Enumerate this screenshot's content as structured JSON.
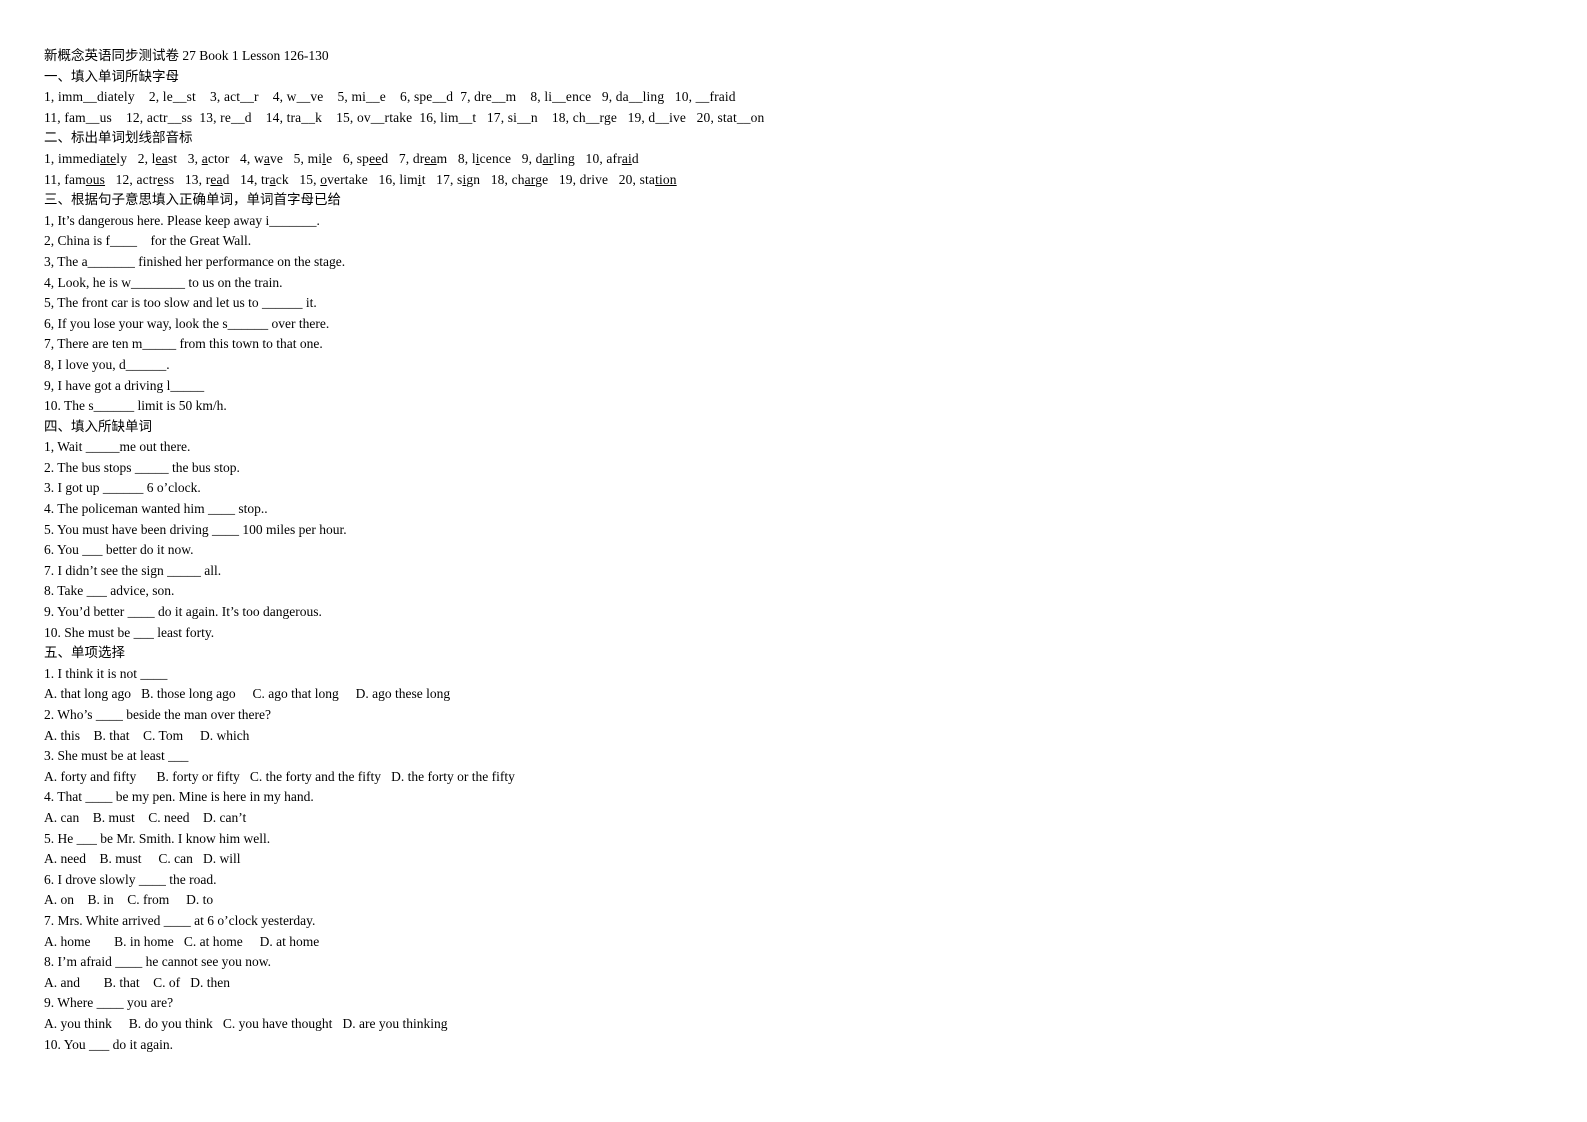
{
  "document": {
    "title": "新概念英语同步测试卷 27 Book 1 Lesson 126-130",
    "sections": [
      {
        "id": "section-1",
        "heading": "一、填入单词所缺字母",
        "lines": [
          "1, imm__diately    2, le__st    3, act__r    4, w__ve    5, mi__e    6, spe__d  7, dre__m    8, li__ence   9, da__ling   10, __fraid",
          "11, fam__us    12, actr__ss  13, re__d    14, tra__k    15, ov__rtake  16, lim__t   17, si__n    18, ch__rge   19, d__ive   20, stat__on"
        ]
      },
      {
        "id": "section-2",
        "heading": "二、标出单词划线部音标",
        "items_row1": [
          {
            "n": "1,",
            "pre": "immedi",
            "mark": "ate",
            "post": "ly"
          },
          {
            "n": "2,",
            "pre": "l",
            "mark": "ea",
            "post": "st"
          },
          {
            "n": "3,",
            "pre": "",
            "mark": "a",
            "post": "ctor"
          },
          {
            "n": "4,",
            "pre": "w",
            "mark": "a",
            "post": "ve"
          },
          {
            "n": "5,",
            "pre": "mi",
            "mark": "l",
            "post": "e"
          },
          {
            "n": "6,",
            "pre": "sp",
            "mark": "ee",
            "post": "d"
          },
          {
            "n": "7,",
            "pre": "dr",
            "mark": "ea",
            "post": "m"
          },
          {
            "n": "8,",
            "pre": "l",
            "mark": "i",
            "post": "cence"
          },
          {
            "n": "9,",
            "pre": "d",
            "mark": "ar",
            "post": "ling"
          },
          {
            "n": "10,",
            "pre": "afr",
            "mark": "ai",
            "post": "d"
          }
        ],
        "items_row2": [
          {
            "n": "11,",
            "pre": "fam",
            "mark": "ous",
            "post": ""
          },
          {
            "n": "12,",
            "pre": "actr",
            "mark": "e",
            "post": "ss"
          },
          {
            "n": "13,",
            "pre": "r",
            "mark": "ea",
            "post": "d"
          },
          {
            "n": "14,",
            "pre": "tr",
            "mark": "a",
            "post": "ck"
          },
          {
            "n": "15,",
            "pre": "",
            "mark": "o",
            "post": "vertake"
          },
          {
            "n": "16,",
            "pre": "lim",
            "mark": "i",
            "post": "t"
          },
          {
            "n": "17,",
            "pre": "s",
            "mark": "i",
            "post": "gn"
          },
          {
            "n": "18,",
            "pre": "ch",
            "mark": "ar",
            "post": "ge"
          },
          {
            "n": "19,",
            "pre": "drive",
            "mark": "",
            "post": ""
          },
          {
            "n": "20,",
            "pre": "sta",
            "mark": "tion",
            "post": ""
          }
        ]
      },
      {
        "id": "section-3",
        "heading": "三、根据句子意思填入正确单词，单词首字母已给",
        "questions": [
          "1, It’s dangerous here. Please keep away i_______.",
          "2, China is f____    for the Great Wall.",
          "3, The a_______ finished her performance on the stage.",
          "4, Look, he is w________ to us on the train.",
          "5, The front car is too slow and let us to ______ it.",
          "6, If you lose your way, look the s______ over there.",
          "7, There are ten m_____ from this town to that one.",
          "8, I love you, d______.",
          "9, I have got a driving l_____",
          "10. The s______ limit is 50 km/h."
        ]
      },
      {
        "id": "section-4",
        "heading": "四、填入所缺单词",
        "questions": [
          "1, Wait _____me out there.",
          "2. The bus stops _____ the bus stop.",
          "3. I got up ______ 6 o’clock.",
          "4. The policeman wanted him ____ stop..",
          "5. You must have been driving ____ 100 miles per hour.",
          "6. You ___ better do it now.",
          "7. I didn’t see the sign _____ all.",
          "8. Take ___ advice, son.",
          "9. You’d better ____ do it again. It’s too dangerous.",
          "10. She must be ___ least forty."
        ]
      },
      {
        "id": "section-5",
        "heading": "五、单项选择",
        "questions": [
          {
            "stem": "1. I think it is not ____",
            "options": "A. that long ago   B. those long ago     C. ago that long     D. ago these long"
          },
          {
            "stem": "2. Who’s ____ beside the man over there?",
            "options": "A. this    B. that    C. Tom     D. which"
          },
          {
            "stem": "3. She must be at least ___",
            "options": "A. forty and fifty      B. forty or fifty   C. the forty and the fifty   D. the forty or the fifty"
          },
          {
            "stem": "4. That ____ be my pen. Mine is here in my hand.",
            "options": "A. can    B. must    C. need    D. can’t"
          },
          {
            "stem": "5. He ___ be Mr. Smith. I know him well.",
            "options": "A. need    B. must     C. can   D. will"
          },
          {
            "stem": "6. I drove slowly ____ the road.",
            "options": "A. on    B. in    C. from     D. to"
          },
          {
            "stem": "7. Mrs. White arrived ____ at 6 o’clock yesterday.",
            "options": "A. home       B. in home   C. at home     D. at home"
          },
          {
            "stem": "8. I’m afraid ____ he cannot see you now.",
            "options": "A. and       B. that    C. of   D. then"
          },
          {
            "stem": "9. Where ____ you are?",
            "options": "A. you think     B. do you think   C. you have thought   D. are you thinking"
          },
          {
            "stem": "10. You ___ do it again.",
            "options": ""
          }
        ]
      }
    ]
  }
}
